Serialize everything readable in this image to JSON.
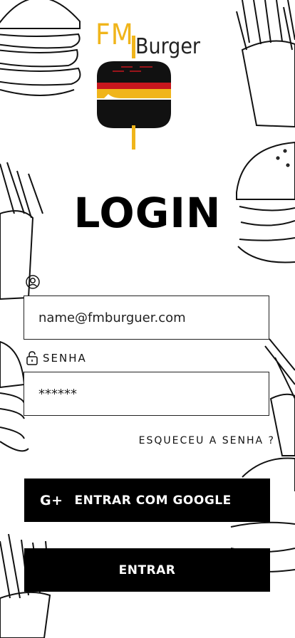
{
  "brand": {
    "fm": "FM",
    "burger": "Burger"
  },
  "title": "LOGIN",
  "email": {
    "value": "name@fmburguer.com"
  },
  "password": {
    "label": "SENHA",
    "value": "******"
  },
  "forgot": "ESQUECEU A SENHA ?",
  "google_button": {
    "icon": "G+",
    "label": "ENTRAR COM GOOGLE"
  },
  "enter_button": "ENTRAR",
  "colors": {
    "accent": "#f0b51b",
    "red": "#c8161d",
    "button": "#000000"
  }
}
